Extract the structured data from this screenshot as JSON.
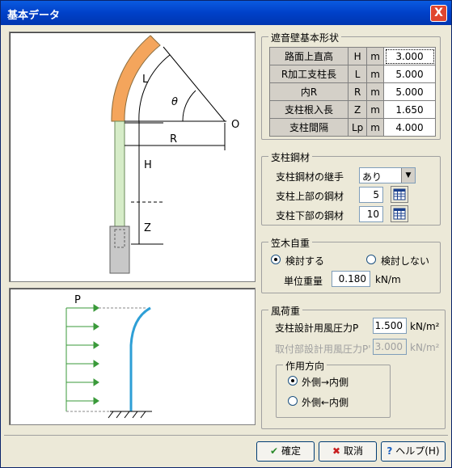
{
  "window": {
    "title": "基本データ",
    "close_glyph": "X"
  },
  "diagram": {
    "label_L": "L",
    "label_theta": "θ",
    "label_O": "O",
    "label_R": "R",
    "label_H": "H",
    "label_Z": "Z",
    "label_P": "P"
  },
  "shape_group": {
    "legend": "遮音壁基本形状",
    "rows": [
      {
        "label": "路面上直高",
        "symbol": "H",
        "unit": "m",
        "value": "3.000"
      },
      {
        "label": "R加工支柱長",
        "symbol": "L",
        "unit": "m",
        "value": "5.000"
      },
      {
        "label": "内R",
        "symbol": "R",
        "unit": "m",
        "value": "5.000"
      },
      {
        "label": "支柱根入長",
        "symbol": "Z",
        "unit": "m",
        "value": "1.650"
      },
      {
        "label": "支柱間隔",
        "symbol": "Lp",
        "unit": "m",
        "value": "4.000"
      }
    ]
  },
  "steel_group": {
    "legend": "支柱鋼材",
    "joint_label": "支柱鋼材の継手",
    "joint_value": "あり",
    "upper_label": "支柱上部の鋼材",
    "upper_value": "5",
    "lower_label": "支柱下部の鋼材",
    "lower_value": "10"
  },
  "weight_group": {
    "legend": "笠木自重",
    "radio_check": "検討する",
    "radio_nocheck": "検討しない",
    "unit_weight_label": "単位重量",
    "unit_weight_value": "0.180",
    "unit_weight_unit": "kN/m"
  },
  "wind_group": {
    "legend": "風荷重",
    "p_label": "支柱設計用風圧力P",
    "p_value": "1.500",
    "p_unit": "kN/m²",
    "pp_label": "取付部設計用風圧力P'",
    "pp_value": "3.000",
    "pp_unit": "kN/m²",
    "dir_legend": "作用方向",
    "dir_out_in": "外側→内側",
    "dir_in_out": "外側←内側"
  },
  "buttons": {
    "ok": "確定",
    "cancel": "取消",
    "help": "ヘルプ(H)"
  },
  "colors": {
    "arc_orange": "#f4a55c",
    "post_green": "#d6ecc8",
    "base_gray": "#c8c8c8",
    "wind_green": "#3a9a3a",
    "post_blue": "#2e9fd6"
  }
}
